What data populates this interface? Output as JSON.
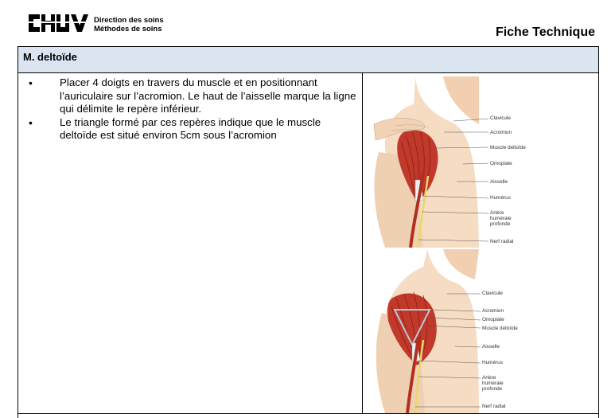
{
  "header": {
    "logo_text": "CHUV",
    "department_line1": "Direction des soins",
    "department_line2": "Méthodes de soins",
    "document_type": "Fiche Technique"
  },
  "section": {
    "title": "M. deltoïde"
  },
  "instructions": [
    "Placer 4 doigts en travers du muscle et en positionnant l’auriculaire sur l’acromion. Le haut de l’aisselle marque la ligne qui délimite le repère inférieur.",
    "Le triangle formé par ces repères indique que le muscle deltoïde est situé environ 5cm sous l’acromion"
  ],
  "figure_1": {
    "labels": [
      "Clavicule",
      "Acromion",
      "Muscle deltoïde",
      "Omoplate",
      "Aisselle",
      "Humérus",
      "Artère humérale profonde",
      "Nerf radial"
    ]
  },
  "figure_2": {
    "labels": [
      "Clavicule",
      "Acromion",
      "Omoplate",
      "Muscle deltoïde",
      "Aisselle",
      "Humérus",
      "Artère humérale profonde",
      "Nerf radial"
    ]
  },
  "colors": {
    "section_bar": "#dbe5f1",
    "skin": "#f6dcc3",
    "muscle": "#c0392b",
    "nerve": "#e8d96a"
  }
}
